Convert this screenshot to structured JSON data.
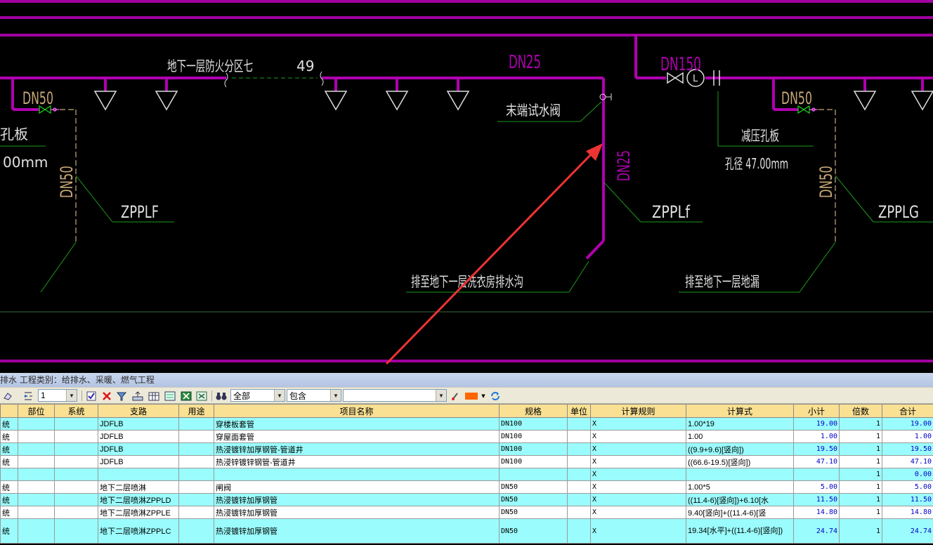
{
  "drawing": {
    "labels": {
      "zone": "地下一层防火分区七",
      "num": "49",
      "dn25_top": "DN25",
      "dn150": "DN150",
      "dn50_left": "DN50",
      "dn50_right": "DN50",
      "end_valve": "末端试水阀",
      "left_orifice": "孔板",
      "left_mm": "00mm",
      "dn50_v_left": "DN50",
      "zpplf": "ZPPLF",
      "dn25_v": "DN25",
      "zpplf2": "ZPPLf",
      "orifice_right": "减压孔板",
      "diameter_right": "孔径 47.00mm",
      "dn50_v_right": "DN50",
      "zpplg": "ZPPLG",
      "drain_left": "排至地下一层洗衣房排水沟",
      "drain_right": "排至地下一层地漏",
      "valve_L": "L"
    },
    "colors": {
      "pipe": "#b000b0",
      "text": "#c8a878",
      "leader": "#1c9a1c",
      "arrow": "#ee3333"
    }
  },
  "panel": {
    "title": "排水 工程类别：给排水、采暖、燃气工程"
  },
  "toolbar": {
    "level_value": "1",
    "filter_value": "全部",
    "match_value": "包含",
    "search_value": "",
    "icons": [
      "eraser-icon",
      "indent-icon",
      "check-icon",
      "delete-icon",
      "filter-icon",
      "sum-icon",
      "grid-icon",
      "export-icon",
      "excel-icon",
      "binoculars-icon",
      "brush-icon",
      "color-icon",
      "refresh-icon"
    ],
    "highlight_color": "#ff6600"
  },
  "table": {
    "columns": [
      "",
      "部位",
      "系统",
      "支路",
      "用途",
      "项目名称",
      "规格",
      "单位",
      "计算规则",
      "计算式",
      "小计",
      "倍数",
      "合计"
    ],
    "rows": [
      {
        "c0": "统",
        "c1": "",
        "c2": "",
        "c3": "JDFLB",
        "c4": "",
        "c5": "穿楼板套管",
        "c6": "DN100",
        "c7": "",
        "c8": "X",
        "c9": "1.00*19",
        "c10": "19.00",
        "c11": "1",
        "c12": "19.00",
        "style": "cy"
      },
      {
        "c0": "统",
        "c1": "",
        "c2": "",
        "c3": "JDFLB",
        "c4": "",
        "c5": "穿屋面套管",
        "c6": "DN100",
        "c7": "",
        "c8": "X",
        "c9": "1.00",
        "c10": "1.00",
        "c11": "1",
        "c12": "1.00",
        "style": "wh"
      },
      {
        "c0": "统",
        "c1": "",
        "c2": "",
        "c3": "JDFLB",
        "c4": "",
        "c5": "热浸镀锌加厚钢管-管道井",
        "c6": "DN100",
        "c7": "",
        "c8": "X",
        "c9": "((9.9+9.6)[竖向])",
        "c10": "19.50",
        "c11": "1",
        "c12": "19.50",
        "style": "cy"
      },
      {
        "c0": "统",
        "c1": "",
        "c2": "",
        "c3": "JDFLB",
        "c4": "",
        "c5": "热浸锌镀锌钢管-管道井",
        "c6": "DN100",
        "c7": "",
        "c8": "X",
        "c9": "((66.6-19.5)[竖向])",
        "c10": "47.10",
        "c11": "1",
        "c12": "47.10",
        "style": "wh"
      },
      {
        "c0": "",
        "c1": "",
        "c2": "",
        "c3": "",
        "c4": "",
        "c5": "",
        "c6": "",
        "c7": "",
        "c8": "X",
        "c9": "",
        "c10": "",
        "c11": "1",
        "c12": "0.00",
        "style": "cy"
      },
      {
        "c0": "统",
        "c1": "",
        "c2": "",
        "c3": "地下二层喷淋",
        "c4": "",
        "c5": "闸阀",
        "c6": "DN50",
        "c7": "",
        "c8": "X",
        "c9": "1.00*5",
        "c10": "5.00",
        "c11": "1",
        "c12": "5.00",
        "style": "wh"
      },
      {
        "c0": "统",
        "c1": "",
        "c2": "",
        "c3": "地下二层喷淋ZPPLD",
        "c4": "",
        "c5": "热浸镀锌加厚钢管",
        "c6": "DN50",
        "c7": "",
        "c8": "X",
        "c9": "((11.4-6)[竖向])+6.10[水",
        "c10": "11.50",
        "c11": "1",
        "c12": "11.50",
        "style": "cy"
      },
      {
        "c0": "统",
        "c1": "",
        "c2": "",
        "c3": "地下二层喷淋ZPPLE",
        "c4": "",
        "c5": "热浸镀锌加厚钢管",
        "c6": "DN50",
        "c7": "",
        "c8": "X",
        "c9": "9.40[竖向]+((11.4-6)[竖",
        "c10": "14.80",
        "c11": "1",
        "c12": "14.80",
        "style": "wh"
      },
      {
        "c0": "统",
        "c1": "",
        "c2": "",
        "c3": "地下二层喷淋ZPPLC",
        "c4": "",
        "c5": "热浸镀锌加厚钢管",
        "c6": "DN50",
        "c7": "",
        "c8": "X",
        "c9": "19.34[水平]+((11.4-6)[竖向])",
        "c10": "24.74",
        "c11": "1",
        "c12": "24.74",
        "style": "cy tall"
      }
    ]
  }
}
